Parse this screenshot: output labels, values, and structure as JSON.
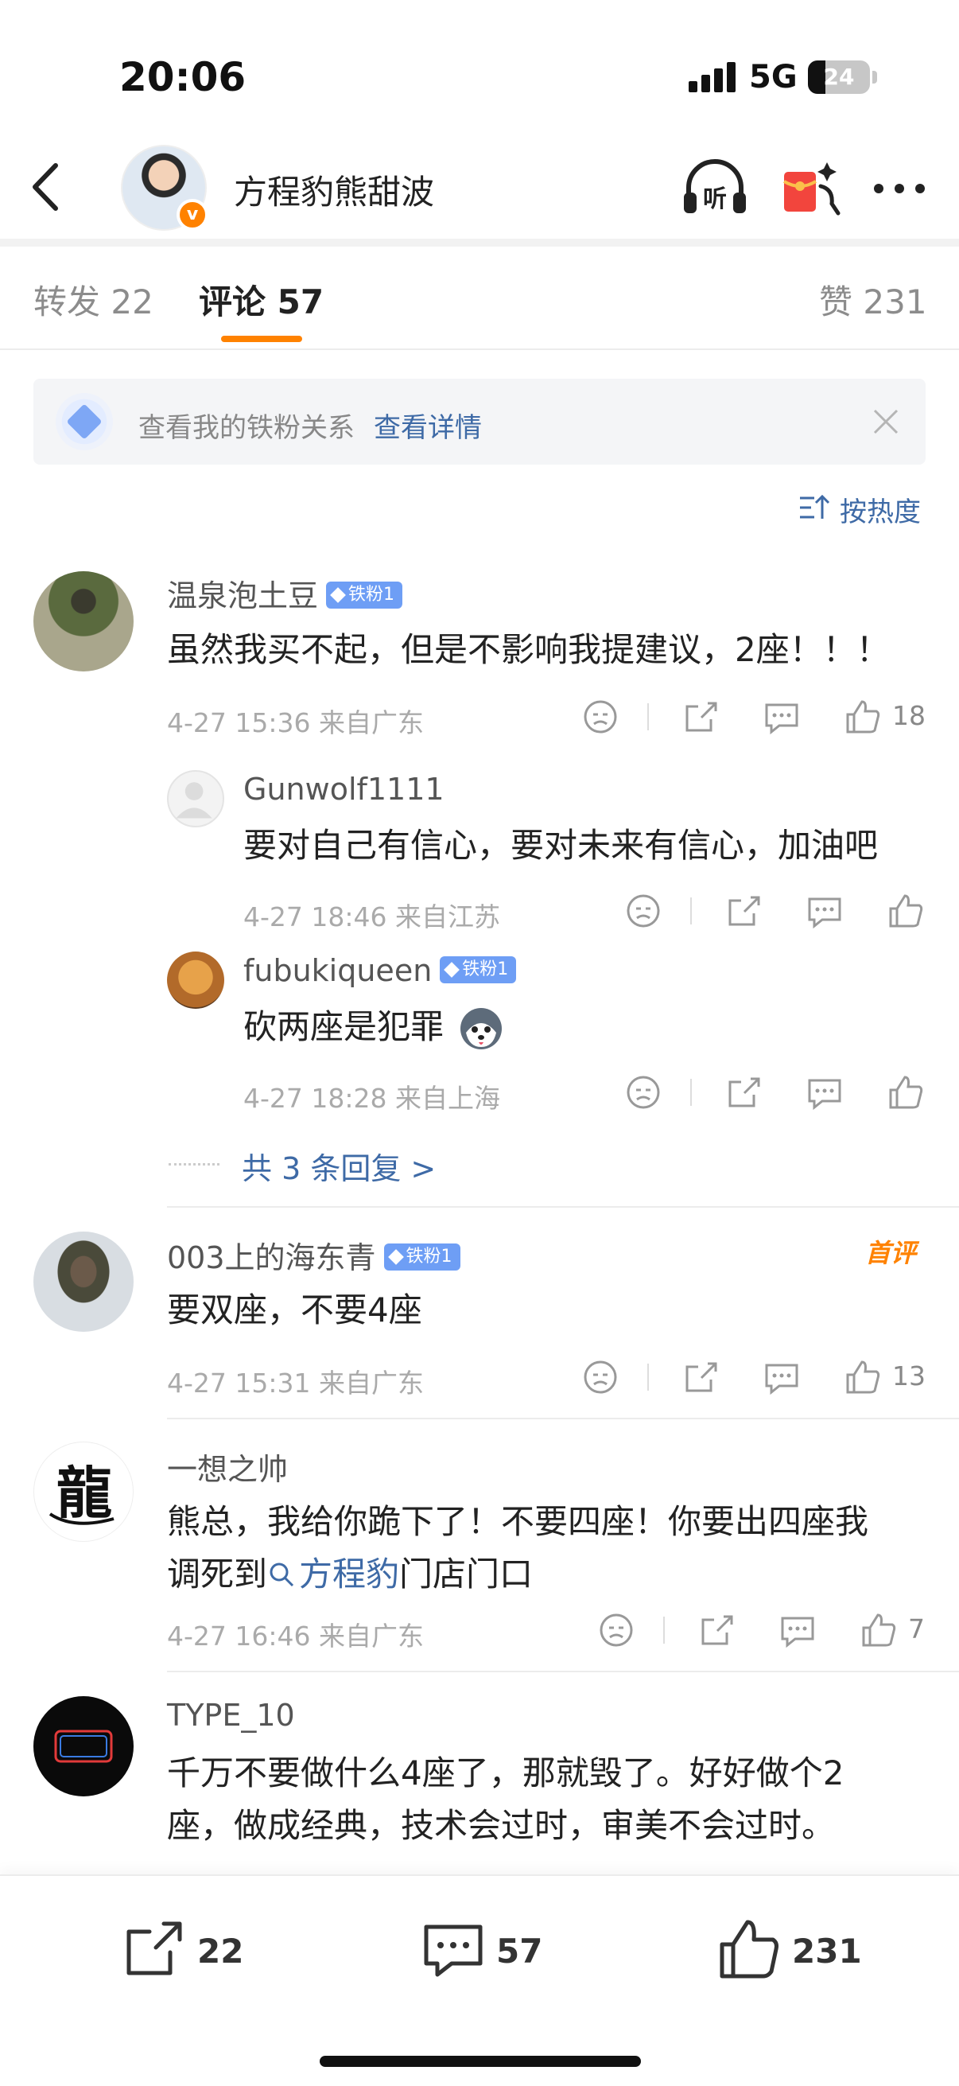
{
  "status_bar": {
    "time": "20:06",
    "network": "5G",
    "battery": "24"
  },
  "header": {
    "account_name": "方程豹熊甜波"
  },
  "tabs": {
    "repost_label": "转发",
    "repost_count": "22",
    "comment_label": "评论",
    "comment_count": "57",
    "like_label": "赞",
    "like_count": "231"
  },
  "fan_banner": {
    "text": "查看我的铁粉关系",
    "link": "查看详情"
  },
  "sort": {
    "label": "按热度"
  },
  "comments": [
    {
      "user": "温泉泡土豆",
      "badge": "铁粉1",
      "text": "虽然我买不起，但是不影响我提建议，2座！！！",
      "meta": "4-27 15:36 来自广东",
      "likes": "18",
      "replies": [
        {
          "user": "Gunwolf1111",
          "text": "要对自己有信心，要对未来有信心，加油吧",
          "meta": "4-27 18:46 来自江苏"
        },
        {
          "user": "fubukiqueen",
          "badge": "铁粉1",
          "text": "砍两座是犯罪",
          "meta": "4-27 18:28 来自上海"
        }
      ],
      "more_replies": "共 3 条回复 >"
    },
    {
      "user": "003上的海东青",
      "badge": "铁粉1",
      "first_badge": "首评",
      "text": "要双座，不要4座",
      "meta": "4-27 15:31 来自广东",
      "likes": "13"
    },
    {
      "user": "一想之帅",
      "text_line1": "熊总，我给你跪下了！不要四座！你要出四座我",
      "text_pre": "调死到",
      "topic": "方程豹",
      "text_post": "门店门口",
      "meta": "4-27 16:46 来自广东",
      "likes": "7"
    },
    {
      "user": "TYPE_10",
      "text_line1": "千万不要做什么4座了，那就毁了。好好做个2",
      "text_line2": "座，做成经典，技术会过时，审美不会过时。"
    }
  ],
  "bottom_bar": {
    "repost_count": "22",
    "comment_count": "57",
    "like_count": "231"
  }
}
